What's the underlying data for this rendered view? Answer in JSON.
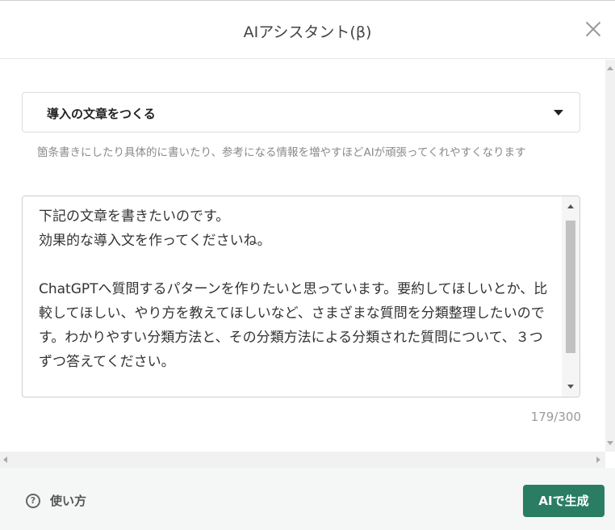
{
  "dialog": {
    "title": "AIアシスタント(β)",
    "close_icon": "close-icon"
  },
  "template_select": {
    "selected": "導入の文章をつくる"
  },
  "help_text": "箇条書きにしたり具体的に書いたり、参考になる情報を増やすほどAIが頑張ってくれやすくなります",
  "prompt": {
    "value": "下記の文章を書きたいのです。\n効果的な導入文を作ってくださいね。\n\nChatGPTへ質問するパターンを作りたいと思っています。要約してほしいとか、比較してほしい、やり方を教えてほしいなど、さまざまな質問を分類整理したいのです。わかりやすい分類方法と、その分類方法による分類された質問について、３つずつ答えてください。",
    "counter": "179/300"
  },
  "footer": {
    "help_label": "使い方",
    "help_icon_glyph": "?",
    "generate_label": "AIで生成"
  },
  "colors": {
    "accent": "#2a7d63",
    "footer_bg": "#f4f7f6"
  }
}
